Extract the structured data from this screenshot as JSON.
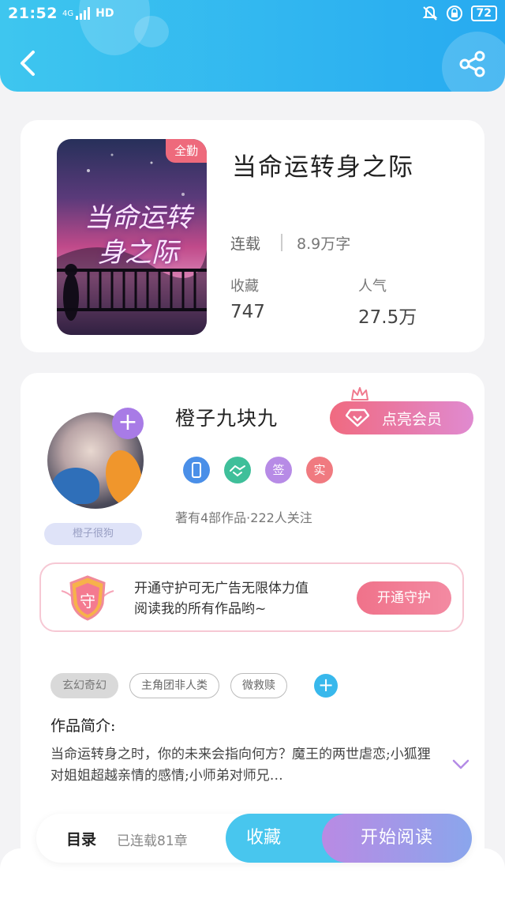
{
  "status_bar": {
    "time": "21:52",
    "network": "4G",
    "hd": "HD",
    "battery": "72"
  },
  "colors": {
    "header": "#2fb6f0",
    "accent_pink": "#f06a80",
    "accent_purple": "#a87be6",
    "accent_blue": "#48c6ee"
  },
  "book": {
    "cover_badge": "全勤",
    "cover_title": "当命运转身之际",
    "title": "当命运转身之际",
    "status": "连载",
    "word_count": "8.9万字",
    "stats": [
      {
        "label": "收藏",
        "value": "747"
      },
      {
        "label": "人气",
        "value": "27.5万"
      }
    ]
  },
  "author": {
    "name": "橙子九块九",
    "avatar_tag": "橙子很狗",
    "vip_button": "点亮会员",
    "badges": [
      {
        "icon": "phone-badge-icon",
        "text": ""
      },
      {
        "icon": "handshake-badge-icon",
        "text": ""
      },
      {
        "icon": "sign-badge-icon",
        "text": "签"
      },
      {
        "icon": "verified-badge-icon",
        "text": "实"
      }
    ],
    "stats_text": "著有4部作品·222人关注"
  },
  "guard": {
    "shield_char": "守",
    "line1": "开通守护可无广告无限体力值",
    "line2": "阅读我的所有作品哟~",
    "button": "开通守护"
  },
  "tags": [
    "玄幻奇幻",
    "主角团非人类",
    "微救赎"
  ],
  "intro": {
    "heading": "作品简介:",
    "text": "当命运转身之时，你的未来会指向何方？魔王的两世虐恋;小狐狸对姐姐超越亲情的感情;小师弟对师兄…"
  },
  "bottom_bar": {
    "toc": "目录",
    "chapters": "已连载81章",
    "collect": "收藏",
    "read": "开始阅读"
  }
}
